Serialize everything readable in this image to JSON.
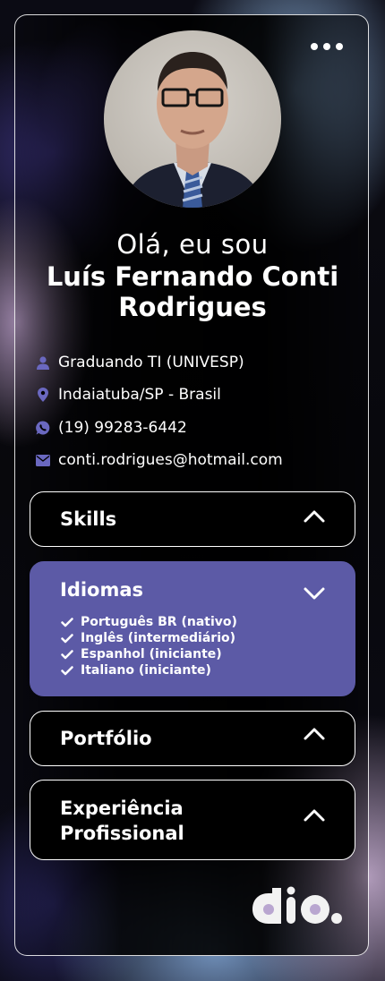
{
  "colors": {
    "accent": "#5c5aa6",
    "text": "#ffffff",
    "card_bg": "#000000"
  },
  "header": {
    "menu_icon": "more-horizontal-icon"
  },
  "profile": {
    "greeting": "Olá, eu sou",
    "name": "Luís Fernando Conti Rodrigues",
    "photo_icon": "profile-photo"
  },
  "info": [
    {
      "icon": "user-icon",
      "text": "Graduando TI (UNIVESP)"
    },
    {
      "icon": "location-pin-icon",
      "text": "Indaiatuba/SP - Brasil"
    },
    {
      "icon": "whatsapp-icon",
      "text": "(19) 99283-6442"
    },
    {
      "icon": "mail-icon",
      "text": "conti.rodrigues@hotmail.com"
    }
  ],
  "sections": {
    "skills": {
      "title": "Skills",
      "expanded": false
    },
    "idiomas": {
      "title": "Idiomas",
      "expanded": true,
      "items": [
        "Português BR (nativo)",
        "Inglês (intermediário)",
        "Espanhol (iniciante)",
        "Italiano (iniciante)"
      ]
    },
    "portfolio": {
      "title": "Portfólio",
      "expanded": false
    },
    "experiencia": {
      "title_line1": "Experiência",
      "title_line2": "Profissional",
      "expanded": false
    }
  },
  "footer": {
    "logo": "dio-logo"
  }
}
